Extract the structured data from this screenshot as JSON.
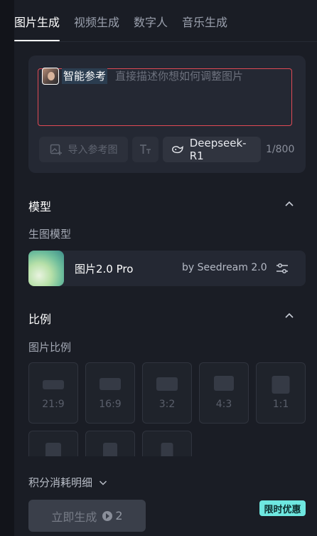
{
  "tabs": [
    {
      "label": "图片生成",
      "active": true
    },
    {
      "label": "视频生成",
      "active": false
    },
    {
      "label": "数字人",
      "active": false
    },
    {
      "label": "音乐生成",
      "active": false
    }
  ],
  "prompt": {
    "reference_label": "智能参考",
    "placeholder": "直接描述你想如何调整图片",
    "import_button": "导入参考图",
    "model_button": "Deepseek-R1",
    "counter": "1/800"
  },
  "model_section": {
    "title": "模型",
    "sublabel": "生图模型",
    "model_name": "图片2.0 Pro",
    "model_by": "by Seedream 2.0"
  },
  "ratio_section": {
    "title": "比例",
    "sublabel": "图片比例",
    "ratios": [
      {
        "label": "21:9"
      },
      {
        "label": "16:9"
      },
      {
        "label": "3:2"
      },
      {
        "label": "4:3"
      },
      {
        "label": "1:1"
      },
      {
        "label": ""
      },
      {
        "label": ""
      },
      {
        "label": ""
      }
    ]
  },
  "cost": {
    "label": "积分消耗明细"
  },
  "generate": {
    "label": "立即生成",
    "credits": "2"
  },
  "promo": {
    "label": "限时优惠"
  },
  "colors": {
    "accent_border": "#e04a55",
    "promo_bg": "#6ee7e0"
  }
}
